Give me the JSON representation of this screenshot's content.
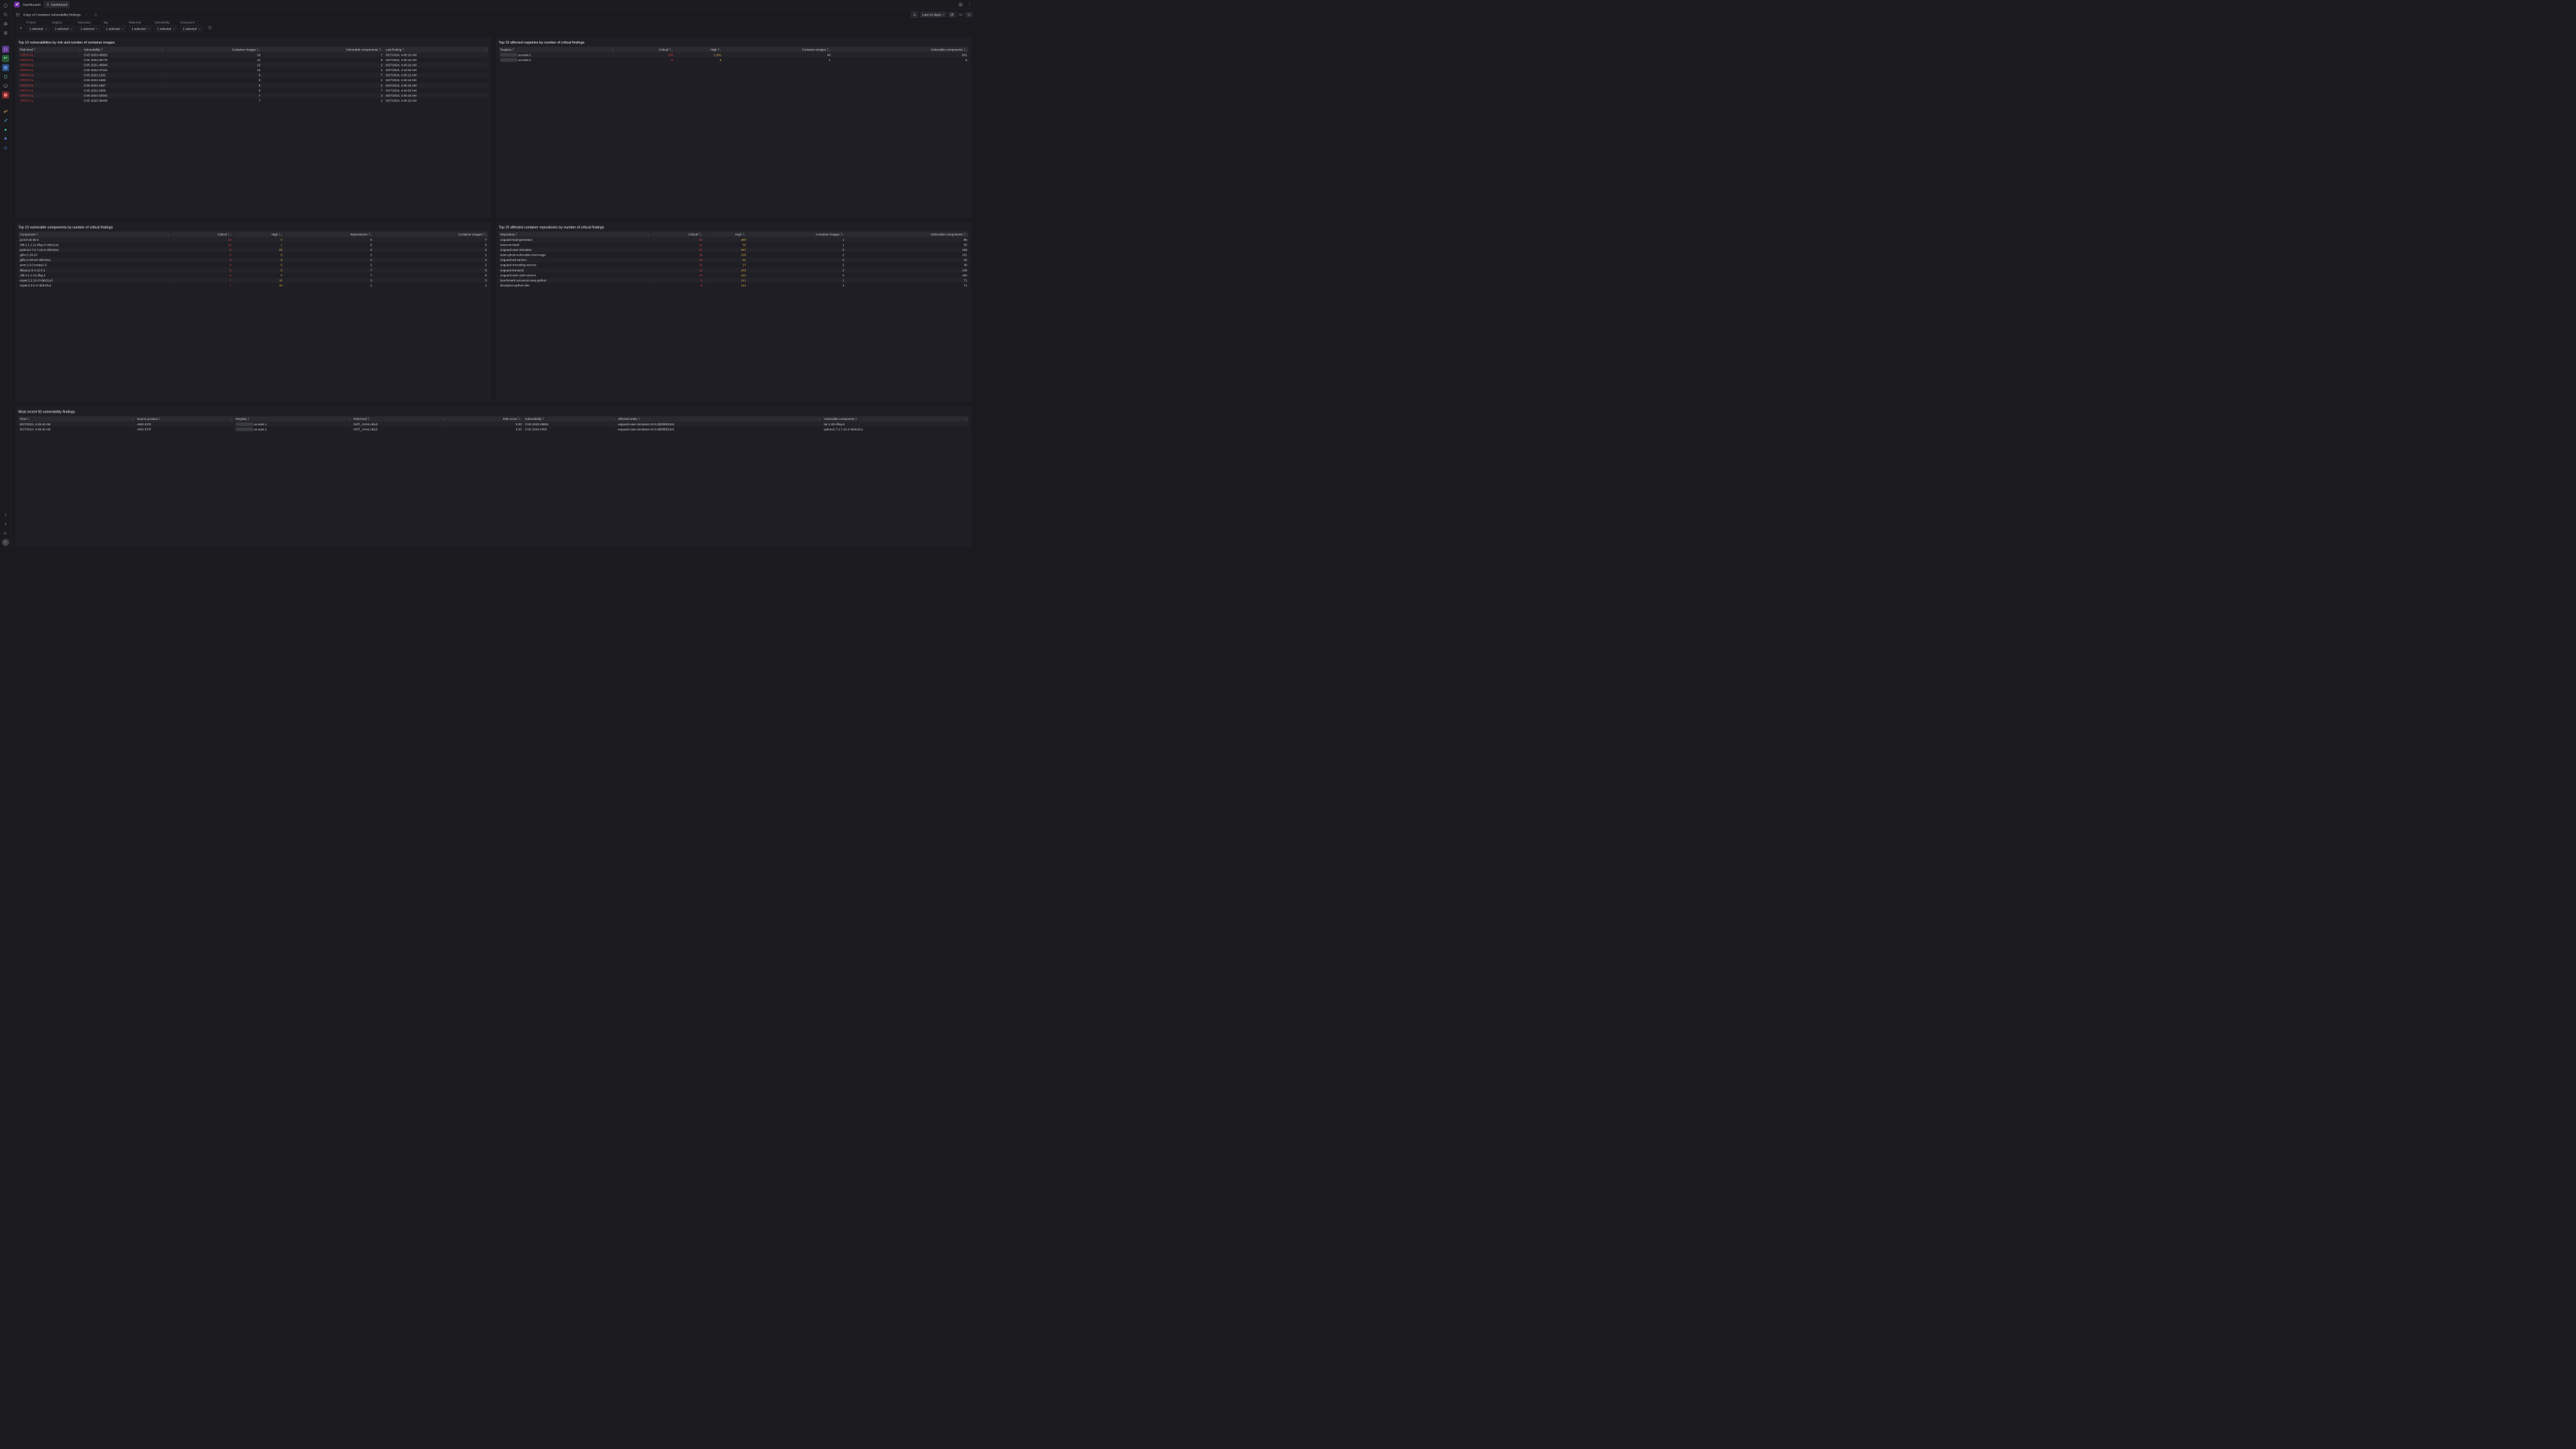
{
  "header": {
    "logo_text": "Dt",
    "crumb": "Dashboards",
    "new_dashboard_btn": "Dashboard",
    "page_title": "Copy of Container vulnerability findings",
    "time_range": "Last 14 days"
  },
  "filters": [
    {
      "label": "Product",
      "value": "1 selected"
    },
    {
      "label": "Registry",
      "value": "1 selected"
    },
    {
      "label": "Repository",
      "value": "1 selected"
    },
    {
      "label": "Tag",
      "value": "1 selected"
    },
    {
      "label": "RiskLevel",
      "value": "1 selected"
    },
    {
      "label": "Vulnerability",
      "value": "1 selected"
    },
    {
      "label": "Component",
      "value": "1 selected"
    }
  ],
  "panels": {
    "top_vulns": {
      "title": "Top 10 vulnerabilities by risk and number of container images",
      "headers": [
        "Risk level",
        "Vulnerability",
        "Container images",
        "Vulnerable components",
        "Last finding"
      ],
      "rows": [
        [
          "CRITICAL",
          "CVE-2023-45853",
          "29",
          "7",
          "6/27/2024, 4:45:16 AM"
        ],
        [
          "CRITICAL",
          "CVE-2023-25775",
          "12",
          "9",
          "6/27/2024, 4:45:16 AM"
        ],
        [
          "CRITICAL",
          "CVE-2021-46848",
          "12",
          "2",
          "6/27/2024, 4:45:16 AM"
        ],
        [
          "CRITICAL",
          "CVE-2022-37434",
          "10",
          "4",
          "6/27/2024, 4:44:53 AM"
        ],
        [
          "CRITICAL",
          "CVE-2022-1292",
          "9",
          "7",
          "6/27/2024, 4:45:12 AM"
        ],
        [
          "CRITICAL",
          "CVE-2022-1586",
          "9",
          "2",
          "6/27/2024, 4:45:16 AM"
        ],
        [
          "CRITICAL",
          "CVE-2022-1587",
          "9",
          "2",
          "6/27/2024, 4:45:16 AM"
        ],
        [
          "CRITICAL",
          "CVE-2022-2068",
          "8",
          "7",
          "6/27/2024, 4:44:53 AM"
        ],
        [
          "CRITICAL",
          "CVE-2024-32002",
          "7",
          "3",
          "6/27/2024, 4:45:16 AM"
        ],
        [
          "CRITICAL",
          "CVE-2023-38408",
          "7",
          "2",
          "6/27/2024, 4:45:16 AM"
        ]
      ]
    },
    "top_registries": {
      "title": "Top 10 affected registries by number of critical findings",
      "headers": [
        "Registry",
        "Critical",
        "High",
        "Container images",
        "Vulnerable components"
      ],
      "rows": [
        [
          "████████████.us-east-1",
          "239",
          "2,391",
          "46",
          "601"
        ],
        [
          "████████████.us-east-1",
          "9",
          "9",
          "1",
          "5"
        ]
      ]
    },
    "top_components": {
      "title": "Top 10 vulnerable components by number of critical findings",
      "headers": [
        "Component",
        "Critical",
        "High",
        "Repositories",
        "Container images"
      ],
      "rows": [
        [
          "pcre2:10.36-2",
          "14",
          "0",
          "6",
          "7"
        ],
        [
          "zlib:1:1.2.11.dfsg-2+deb11u1",
          "12",
          "1",
          "6",
          "6"
        ],
        [
          "python2.7:2.7.16-2+deb10u1",
          "8",
          "28",
          "4",
          "4"
        ],
        [
          "glibc:2.28-10",
          "8",
          "8",
          "2",
          "2"
        ],
        [
          "glibc:2.28-10+deb10u1",
          "8",
          "8",
          "2",
          "2"
        ],
        [
          "aom:1.0.0.errata1-3",
          "8",
          "6",
          "2",
          "2"
        ],
        [
          "libtasn1-6:4.16.0-2",
          "8",
          "0",
          "7",
          "8"
        ],
        [
          "zlib:1:1.2.13.dfsg-1",
          "8",
          "0",
          "7",
          "8"
        ],
        [
          "expat:2.2.10-2+deb11u3",
          "7",
          "16",
          "3",
          "3"
        ],
        [
          "expat:2.2.6-2+deb10u1",
          "7",
          "10",
          "1",
          "1"
        ]
      ]
    },
    "top_repos": {
      "title": "Top 10 affected container repositories by number of critical findings",
      "headers": [
        "Repository",
        "Critical",
        "High",
        "Container images",
        "Vulnerable components"
      ],
      "rows": [
        [
          "unguard-load-generator",
          "34",
          "389",
          "1",
          "86"
        ],
        [
          "insecure-bank",
          "22",
          "50",
          "1",
          "50"
        ],
        [
          "unguard-user-simulator",
          "21",
          "297",
          "2",
          "136"
        ],
        [
          "team-ghost-vulnerable-test-image",
          "18",
          "100",
          "2",
          "101"
        ],
        [
          "unguard-ad-service",
          "18",
          "51",
          "2",
          "34"
        ],
        [
          "unguard-microblog-service",
          "16",
          "37",
          "2",
          "39"
        ],
        [
          "unguard-frontend",
          "14",
          "246",
          "2",
          "149"
        ],
        [
          "unguard-user-auth-service",
          "13",
          "231",
          "2",
          "150"
        ],
        [
          "benchmark-sut-worst-case-python",
          "9",
          "141",
          "1",
          "71"
        ],
        [
          "deception-python-dev",
          "9",
          "141",
          "1",
          "71"
        ]
      ]
    },
    "recent_findings": {
      "title": "Most recent 50 vulnerability findings",
      "headers": [
        "Time",
        "Source product",
        "Registry",
        "Risk level",
        "Risk score",
        "Vulnerability",
        "Affected entity",
        "Vulnerable component"
      ],
      "rows": [
        [
          "6/27/2024, 4:46:40 AM",
          "AWS ECR",
          "████████.us-east-1",
          "NOT_AVAILABLE",
          "0.00",
          "CVE-2023-39804",
          "unguard-user-simulator:v0.8.0@9f8523c6",
          "tar:1.30+dfsg-6"
        ],
        [
          "6/27/2024, 4:46:40 AM",
          "AWS ECR",
          "████████.us-east-1",
          "NOT_AVAILABLE",
          "0.00",
          "CVE-2024-0450",
          "unguard-user-simulator:v0.8.0@9f8523c6",
          "python2.7:2.7.16-2+deb10u1"
        ]
      ]
    }
  }
}
